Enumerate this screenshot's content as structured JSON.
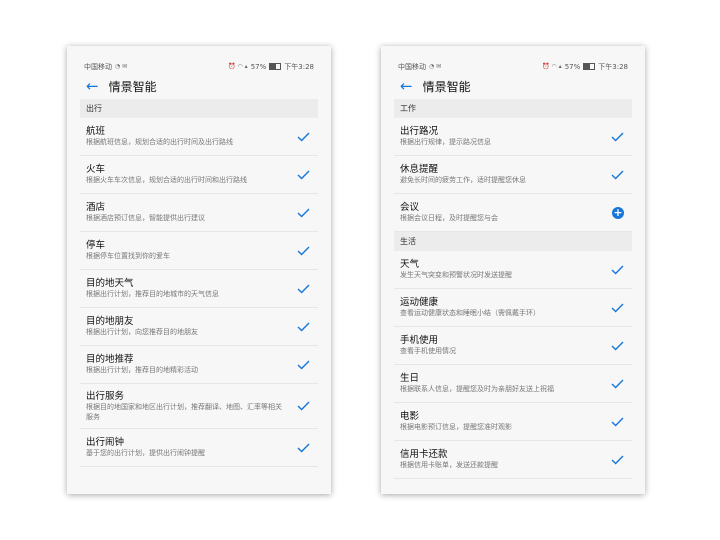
{
  "accent_color": "#1677d8",
  "left": {
    "status": {
      "carrier": "中国移动",
      "battery": "57%",
      "battery_level": 0.57,
      "time": "下午3:28"
    },
    "title": "情景智能",
    "section": "出行",
    "items": [
      {
        "title": "航班",
        "sub": "根据航班信息，规划合适的出行时间及出行路线",
        "state": "check"
      },
      {
        "title": "火车",
        "sub": "根据火车车次信息，规划合适的出行时间和出行路线",
        "state": "check"
      },
      {
        "title": "酒店",
        "sub": "根据酒店预订信息，智能提供出行建议",
        "state": "check"
      },
      {
        "title": "停车",
        "sub": "根据停车位置找到你的爱车",
        "state": "check"
      },
      {
        "title": "目的地天气",
        "sub": "根据出行计划，推荐目的地城市的天气信息",
        "state": "check"
      },
      {
        "title": "目的地朋友",
        "sub": "根据出行计划，向您推荐目的地朋友",
        "state": "check"
      },
      {
        "title": "目的地推荐",
        "sub": "根据出行计划，推荐目的地精彩活动",
        "state": "check"
      },
      {
        "title": "出行服务",
        "sub": "根据目的地国家和地区出行计划，推荐翻译、地图、汇率等相关服务",
        "state": "check"
      },
      {
        "title": "出行闹钟",
        "sub": "基于您的出行计划，提供出行闹钟提醒",
        "state": "check"
      }
    ]
  },
  "right": {
    "status": {
      "carrier": "中国移动",
      "battery": "57%",
      "battery_level": 0.57,
      "time": "下午3:28"
    },
    "title": "情景智能",
    "section1": "工作",
    "items1": [
      {
        "title": "出行路况",
        "sub": "根据出行规律，提示路况信息",
        "state": "check"
      },
      {
        "title": "休息提醒",
        "sub": "避免长时间的疲劳工作，适时提醒您休息",
        "state": "check"
      },
      {
        "title": "会议",
        "sub": "根据会议日程，及时提醒您与会",
        "state": "add"
      }
    ],
    "section2": "生活",
    "items2": [
      {
        "title": "天气",
        "sub": "发生天气突变和预警状况时发送提醒",
        "state": "check"
      },
      {
        "title": "运动健康",
        "sub": "查看运动健康状态和睡眠小结（需佩戴手环）",
        "state": "check"
      },
      {
        "title": "手机使用",
        "sub": "查看手机使用情况",
        "state": "check"
      },
      {
        "title": "生日",
        "sub": "根据联系人信息，提醒您及时为亲朋好友送上祝福",
        "state": "check"
      },
      {
        "title": "电影",
        "sub": "根据电影预订信息，提醒您准时观影",
        "state": "check"
      },
      {
        "title": "信用卡还款",
        "sub": "根据信用卡账单，发送还款提醒",
        "state": "check"
      }
    ]
  }
}
